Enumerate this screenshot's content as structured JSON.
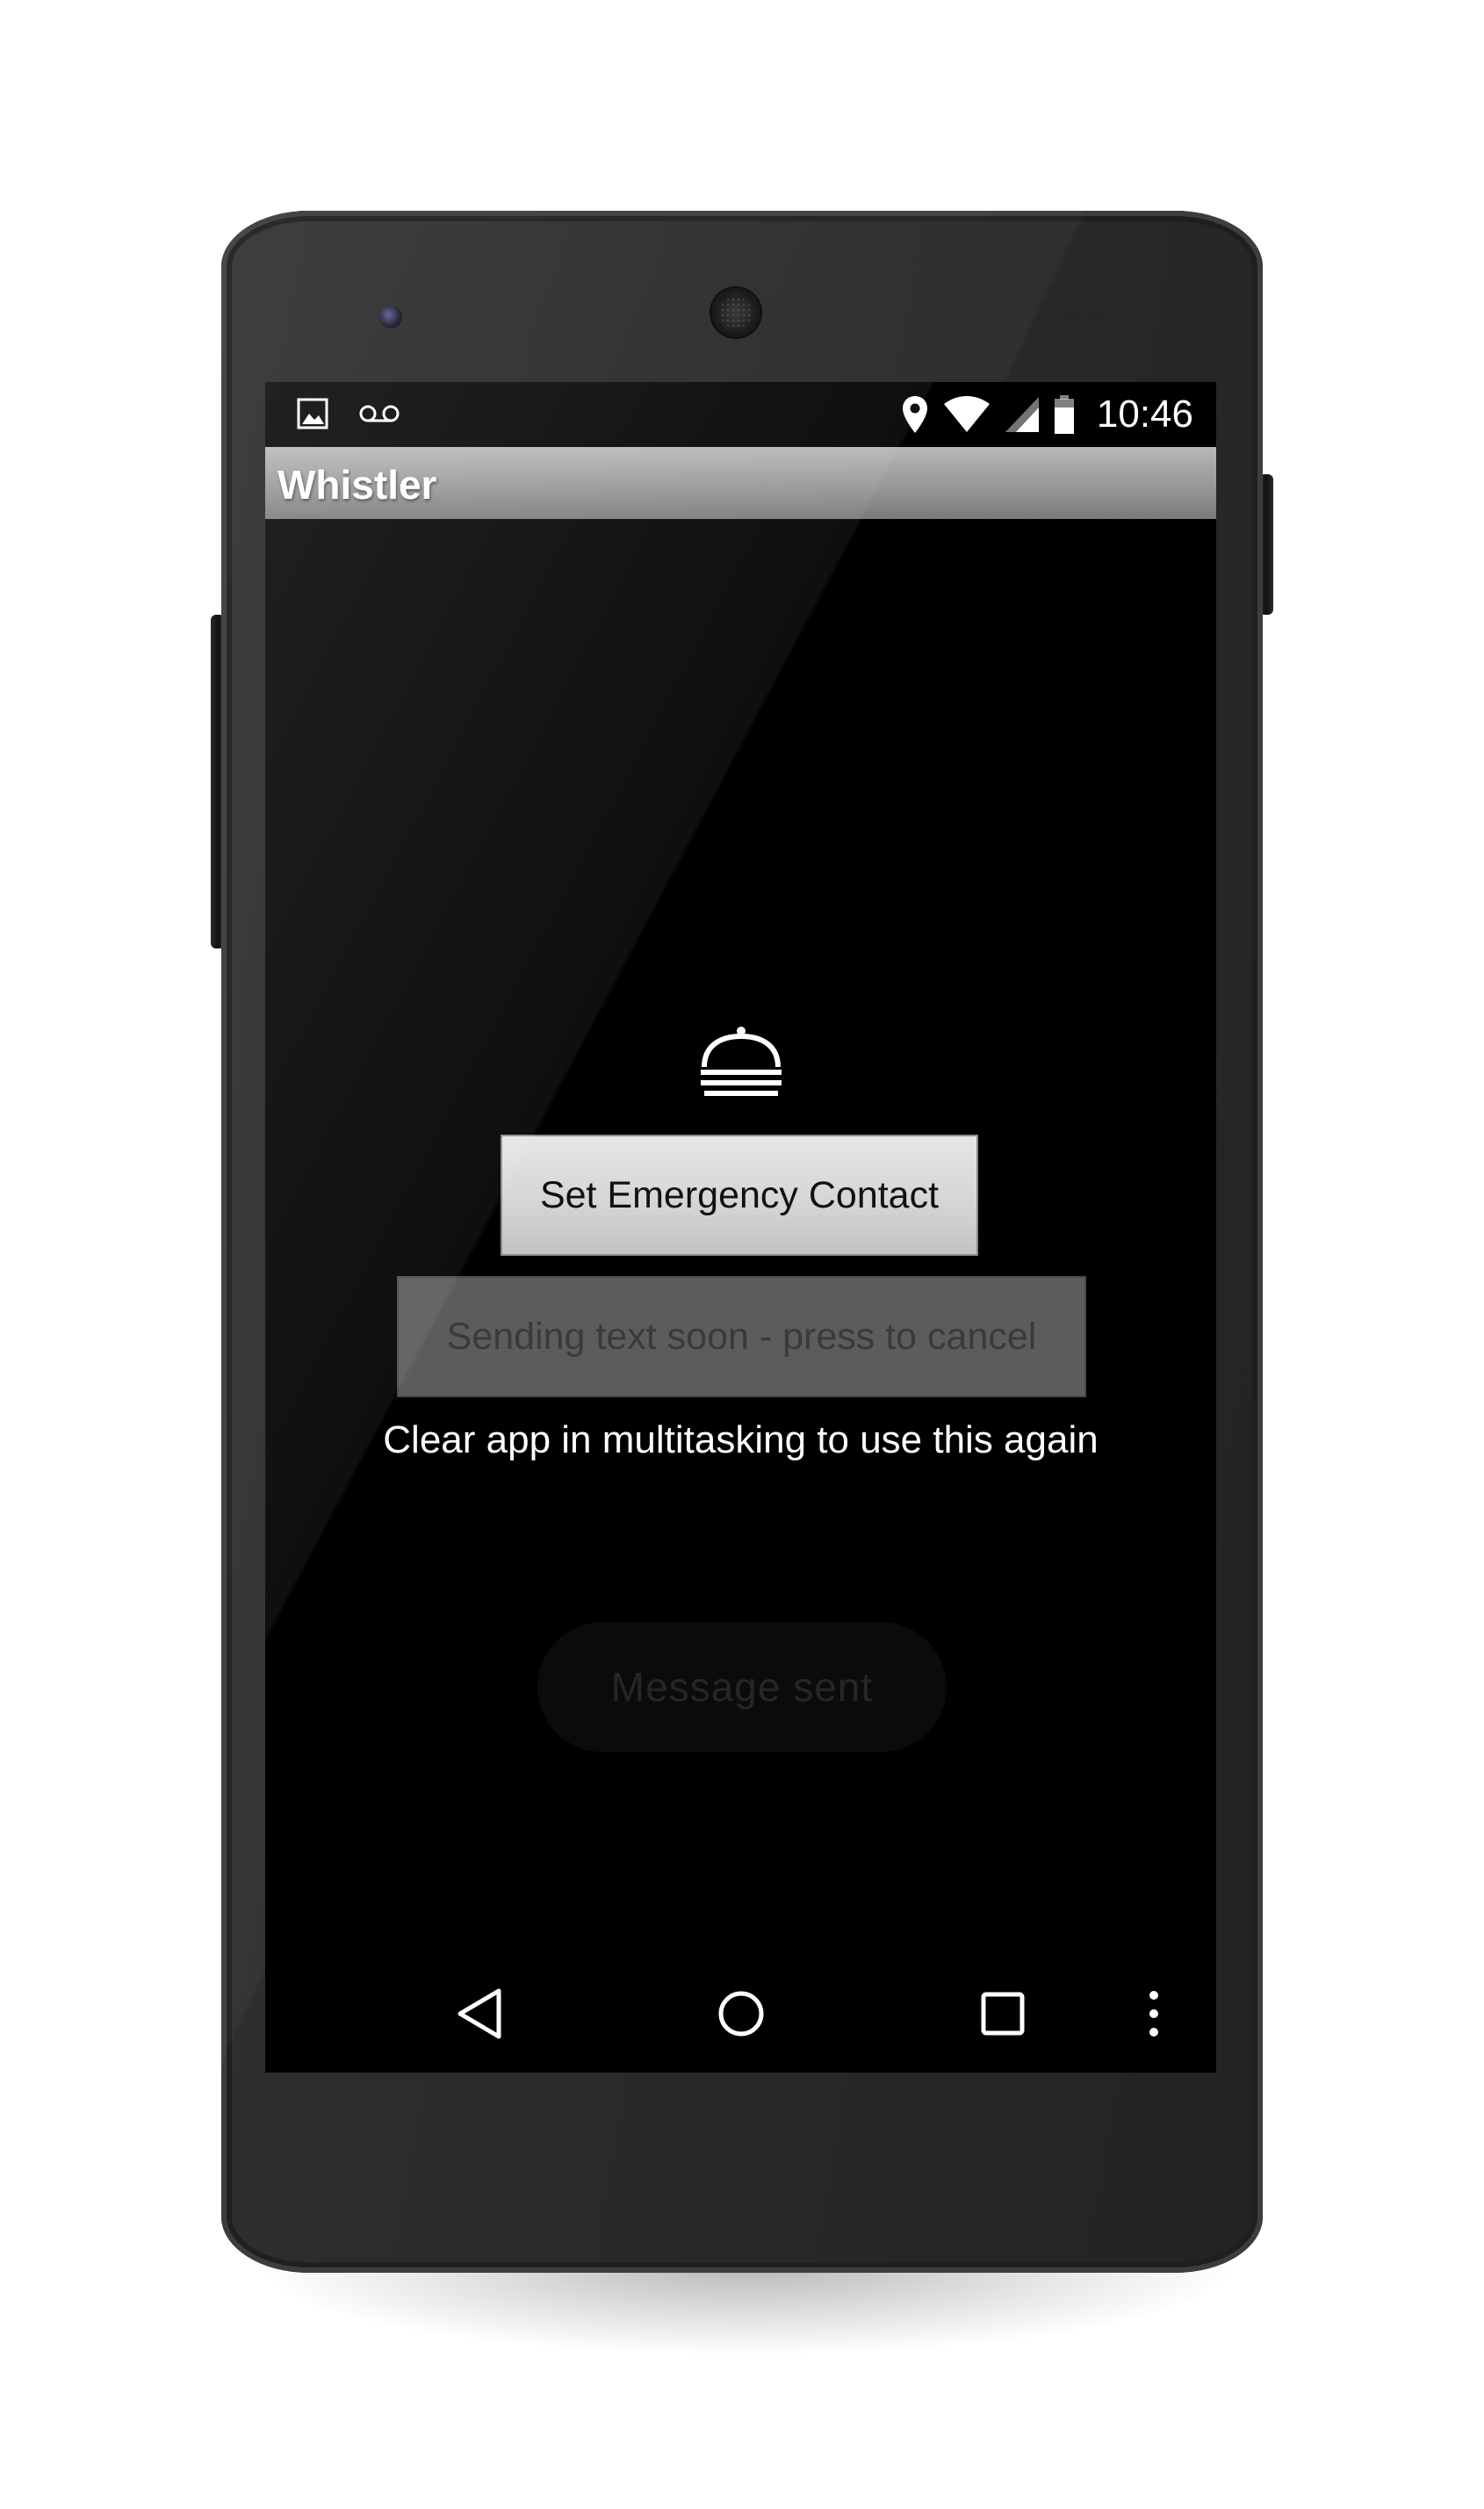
{
  "status_bar": {
    "time": "10:46",
    "left_icons": [
      "image-notification-icon",
      "voicemail-icon"
    ],
    "right_icons": [
      "location-icon",
      "wifi-icon",
      "cell-signal-icon",
      "battery-icon"
    ]
  },
  "app": {
    "title": "Whistler",
    "icon": "service-bell-icon"
  },
  "main": {
    "emergency_button_label": "Set Emergency Contact",
    "cancel_button_label": "Sending text soon - press to cancel",
    "info_text": "Clear app in multitasking to use this again",
    "toast_text": "Message sent"
  },
  "nav_bar": {
    "buttons": [
      "back-icon",
      "home-icon",
      "recents-icon",
      "overflow-menu-icon"
    ]
  },
  "colors": {
    "screen_bg": "#000000",
    "action_bar_top": "#b8b8b8",
    "action_bar_bottom": "#7a7a7a",
    "emergency_button_bg": "#d4d4d4",
    "cancel_button_bg": "#5c5c5c",
    "phone_body": "#2b2b2b"
  }
}
